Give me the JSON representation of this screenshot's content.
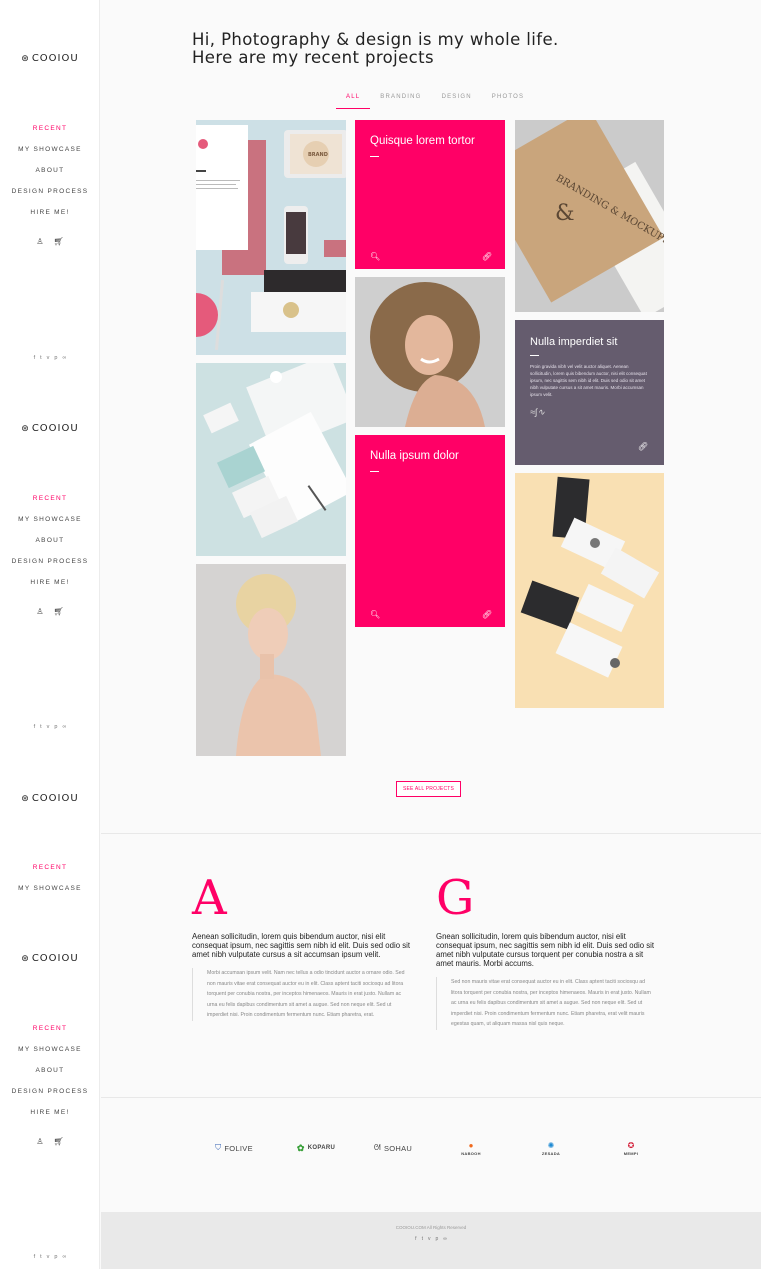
{
  "brand": {
    "logo_text": "COOIOU",
    "logo_icon": "sphere-logo-icon"
  },
  "sidebar": {
    "menus": [
      [
        "RECENT",
        "MY SHOWCASE",
        "ABOUT",
        "DESIGN PROCESS",
        "HIRE ME!"
      ],
      [
        "RECENT",
        "MY SHOWCASE",
        "ABOUT",
        "DESIGN PROCESS",
        "HIRE ME!"
      ],
      [
        "RECENT",
        "MY SHOWCASE"
      ],
      [
        "RECENT",
        "MY SHOWCASE",
        "ABOUT",
        "DESIGN PROCESS",
        "HIRE ME!"
      ]
    ],
    "icons": {
      "user": "user-icon",
      "cart": "cart-icon"
    },
    "socials": [
      "f",
      "t",
      "v",
      "p",
      "∞"
    ],
    "active_color": "#ff0066"
  },
  "hero": {
    "line1": "Hi, Photography & design is my whole life.",
    "line2": "Here are my recent projects"
  },
  "filters": [
    "ALL",
    "BRANDING",
    "DESIGN",
    "PHOTOS"
  ],
  "portfolio": {
    "card1_title": "Quisque lorem tortor",
    "card2_title": "Nulla ipsum dolor",
    "card3_title": "Nulla imperdiet sit",
    "card3_text": "Proin gravida nibh vel velit auctor aliquet. Aenean sollicitudin, lorem quis bibendum auctor, nisi elit consequat ipsum, nec sagittis sem nibh id elit. Duis sed odio sit amet nibh vulputate cursus a sit amet mauris. Morbi accumsan ipsum velit.",
    "branding_mockup_text": "BRANDING & MOCKUPS",
    "stationery_label": "BRAND",
    "accent_color": "#ff0066",
    "purple_color": "#655c6e"
  },
  "see_all_label": "SEE ALL PROJECTS",
  "about": {
    "left": {
      "initial": "A",
      "lead": "Aenean sollicitudin, lorem quis bibendum auctor, nisi elit consequat ipsum, nec sagittis sem nibh id elit. Duis sed odio sit amet nibh vulputate cursus a sit accumsan ipsum velit.",
      "quote": "Morbi accumsan ipsum velit. Nam nec tellus a odio tincidunt auctor a ornare odio. Sed non mauris vitae erat consequat auctor eu in elit. Class aptent taciti sociosqu ad litora torquent per conubia nostra, per inceptos himenaeos. Mauris in erat justo. Nullam ac urna eu felis dapibus condimentum sit amet a augue. Sed non neque elit. Sed ut imperdiet nisi. Proin condimentum fermentum nunc. Etiam pharetra, erat."
    },
    "right": {
      "initial": "G",
      "lead": "Gnean sollicitudin, lorem quis bibendum auctor, nisi elit consequat ipsum, nec sagittis sem nibh id elit. Duis sed odio sit amet nibh vulputate cursus torquent per conubia nostra a sit amet mauris. Morbi accums.",
      "quote": "Sed non mauris vitae erat consequat auctor eu in elit. Class aptent taciti sociosqu ad litora torquent per conubia nostra, per inceptos himenaeos. Mauris in erat justo. Nullam ac urna eu felis dapibus condimentum sit amet a augue. Sed non neque elit. Sed ut imperdiet nisi. Proin condimentum fermentum nunc. Etiam pharetra, erat velit mauris egestas quam, ut aliquam massa nisl quis neque."
    }
  },
  "brands": [
    {
      "name": "FOLIVE",
      "icon": "folive-shield-icon"
    },
    {
      "name": "KOPARU",
      "icon": "koparu-flower-icon"
    },
    {
      "name": "SOHAU",
      "icon": "sohau-cat-icon"
    },
    {
      "name": "NABOOH",
      "icon": "nabooh-circles-icon"
    },
    {
      "name": "ZESADA",
      "icon": "zesada-pinwheel-icon"
    },
    {
      "name": "MEMPI",
      "icon": "mempi-star-icon"
    }
  ],
  "footer": {
    "copyright": "COOIOU.COM All Rights Reserved",
    "socials": [
      "f",
      "t",
      "v",
      "p",
      "∞"
    ]
  }
}
